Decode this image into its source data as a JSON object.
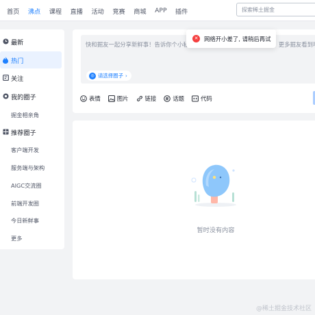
{
  "header": {
    "nav": [
      "首页",
      "沸点",
      "课程",
      "直播",
      "活动",
      "竞赛",
      "商城",
      "APP",
      "插件"
    ],
    "active_nav": "沸点",
    "search_placeholder": "探索稀土掘金"
  },
  "sidebar": {
    "latest": {
      "label": "最新",
      "icon": "clock-icon"
    },
    "hot": {
      "label": "热门",
      "icon": "flame-icon"
    },
    "follow": {
      "label": "关注",
      "icon": "follow-icon"
    },
    "my_circles": {
      "label": "我的圈子",
      "icon": "circle-icon"
    },
    "my_circles_items": [
      "掘金相亲角"
    ],
    "recommended": {
      "label": "推荐圈子",
      "icon": "grid-icon"
    },
    "recommended_items": [
      "客户端开发",
      "服务端与架构",
      "AIGC交流圈",
      "前端开发圈",
      "今日新鲜事",
      "更多"
    ]
  },
  "editor": {
    "placeholder": "快和掘友一起分享新鲜事！告诉你个小秘",
    "placeholder_tail": "更多掘友看到哦",
    "circle_button": "请选择圈子",
    "tools": [
      {
        "label": "表情",
        "icon": "smile-icon"
      },
      {
        "label": "图片",
        "icon": "image-icon"
      },
      {
        "label": "链接",
        "icon": "link-icon"
      },
      {
        "label": "话题",
        "icon": "topic-icon"
      },
      {
        "label": "代码",
        "icon": "code-icon"
      }
    ]
  },
  "feed": {
    "empty_text": "暂时没有内容"
  },
  "toast": {
    "message": "网络开小差了, 请稍后再试",
    "icon": "error-icon"
  },
  "watermark": "@稀土掘金技术社区",
  "colors": {
    "accent": "#1e80ff",
    "error": "#f53f3f",
    "background": "#f2f3f5",
    "active_bg": "#eaf2ff"
  }
}
